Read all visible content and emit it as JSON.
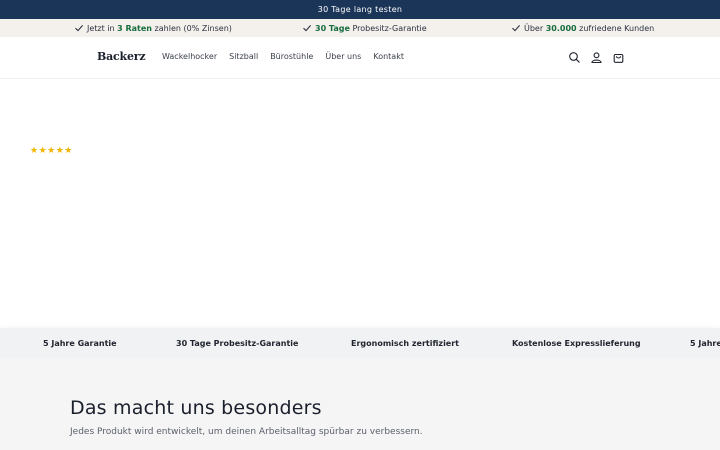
{
  "announcement": {
    "text": "30 Tage lang testen"
  },
  "usp_bar": {
    "items": [
      {
        "pre": "Jetzt in ",
        "bold": "3 Raten",
        "post": " zahlen (0% Zinsen)"
      },
      {
        "pre": "",
        "bold": "30 Tage",
        "post": " Probesitz-Garantie"
      },
      {
        "pre": "Über ",
        "bold": "30.000",
        "post": " zufriedene Kunden"
      }
    ],
    "icon": "check-icon",
    "accent_color": "#176b3e"
  },
  "header": {
    "logo": "Backerz",
    "nav": [
      "Wackelhocker",
      "Sitzball",
      "Bürostühle",
      "Über uns",
      "Kontakt"
    ],
    "icons": [
      "search-icon",
      "account-icon",
      "cart-icon"
    ]
  },
  "hero": {
    "rating_stars": "★★★★★",
    "rating_value": 5
  },
  "ticker": {
    "items": [
      "5 Jahre Garantie",
      "30 Tage Probesitz-Garantie",
      "Ergonomisch zertifiziert",
      "Kostenlose Expresslieferung",
      "5 Jahre"
    ]
  },
  "features_section": {
    "title": "Das macht uns besonders",
    "subtitle": "Jedes Produkt wird entwickelt, um deinen Arbeitsalltag spürbar zu verbessern."
  },
  "colors": {
    "announcement_bg": "#1b3558",
    "usp_bg": "#f4f1ec",
    "star": "#f2b400"
  }
}
